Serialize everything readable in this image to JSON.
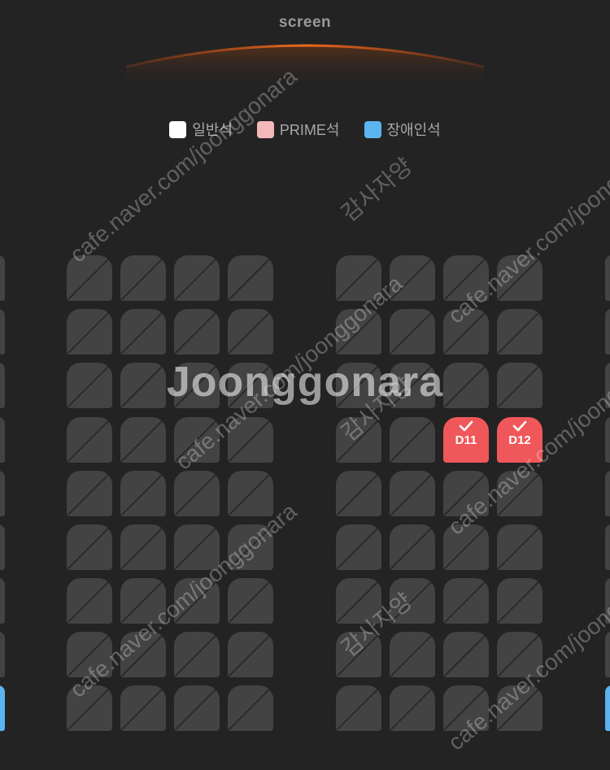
{
  "screen": {
    "label": "screen"
  },
  "legend": [
    {
      "label": "일반석",
      "color": "#ffffff"
    },
    {
      "label": "PRIME석",
      "color": "#f4b8bb"
    },
    {
      "label": "장애인석",
      "color": "#5bb4ef"
    }
  ],
  "seats": {
    "selected": [
      {
        "label": "D11",
        "color": "#f0575a"
      },
      {
        "label": "D12",
        "color": "#f0575a"
      }
    ]
  },
  "watermark": {
    "main": "Joonggonara",
    "diag1": "cafe.naver.com/joonggonara",
    "diag2": "cafe.naver.com/joonggonara",
    "diag3": "cafe.naver.com/joonggonara",
    "diag4": "cafe.naver.com/joonggonara",
    "diag5": "cafe.naver.com/joonggonara",
    "diag6": "cafe.naver.com/joonggonara",
    "stamp1": "감사자양",
    "stamp2": "감사자양",
    "stamp3": "감사자양"
  }
}
